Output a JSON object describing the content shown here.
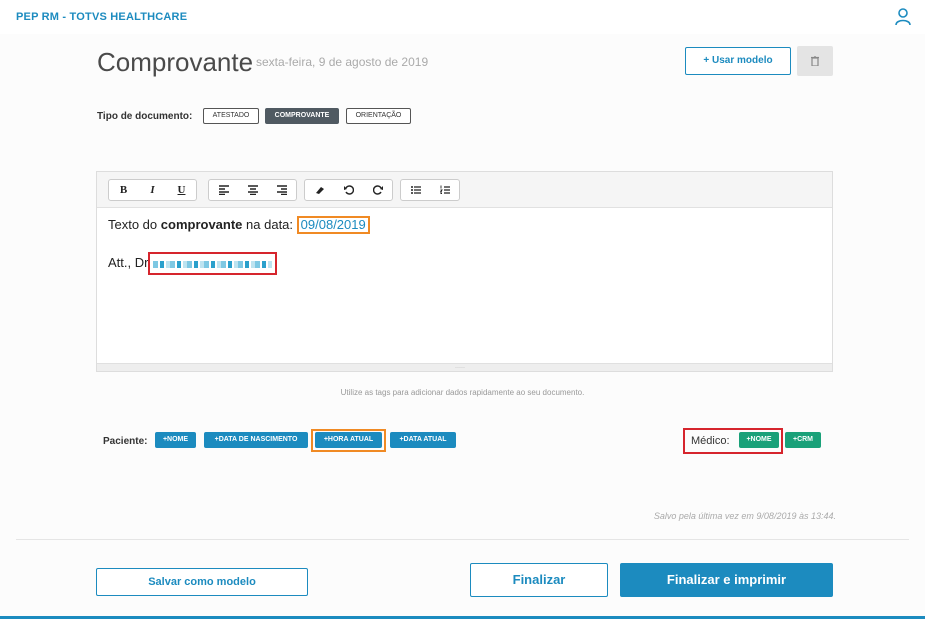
{
  "app": {
    "title": "PEP RM - TOTVS HEALTHCARE"
  },
  "header": {
    "title": "Comprovante",
    "date": "sexta-feira, 9 de agosto de 2019",
    "usar_modelo": "+ Usar modelo"
  },
  "tipo": {
    "label": "Tipo de documento:",
    "options": [
      "ATESTADO",
      "COMPROVANTE",
      "ORIENTAÇÃO"
    ],
    "selected": "COMPROVANTE"
  },
  "editor": {
    "toolbar": [
      "bold-icon",
      "italic-icon",
      "underline-icon",
      "align-left-icon",
      "align-center-icon",
      "align-right-icon",
      "eraser-icon",
      "undo-icon",
      "redo-icon",
      "bullet-list-icon",
      "numbered-list-icon"
    ],
    "toolbar_glyphs": {
      "bold": "B",
      "italic": "I",
      "underline": "U"
    },
    "line1_prefix": "Texto do",
    "line1_bold": "comprovante",
    "line1_middle": " na data:",
    "line1_date": "09/08/2019",
    "line2_prefix": "Att., Dr"
  },
  "hint": "Utilize as tags para adicionar dados rapidamente ao seu documento.",
  "tags": {
    "paciente_label": "Paciente:",
    "paciente": [
      "+NOME",
      "+DATA DE NASCIMENTO",
      "+HORA ATUAL",
      "+DATA ATUAL"
    ],
    "medico_label": "Médico:",
    "medico": [
      "+NOME",
      "+CRM"
    ]
  },
  "saved_text": "Salvo pela última vez em 9/08/2019 às 13:44.",
  "footer": {
    "salvar_modelo": "Salvar como modelo",
    "finalizar": "Finalizar",
    "finalizar_imprimir": "Finalizar e imprimir"
  },
  "colors": {
    "primary": "#1c8bbf",
    "green": "#1aa179",
    "highlight_orange": "#f08a24",
    "highlight_red": "#d6252d"
  }
}
